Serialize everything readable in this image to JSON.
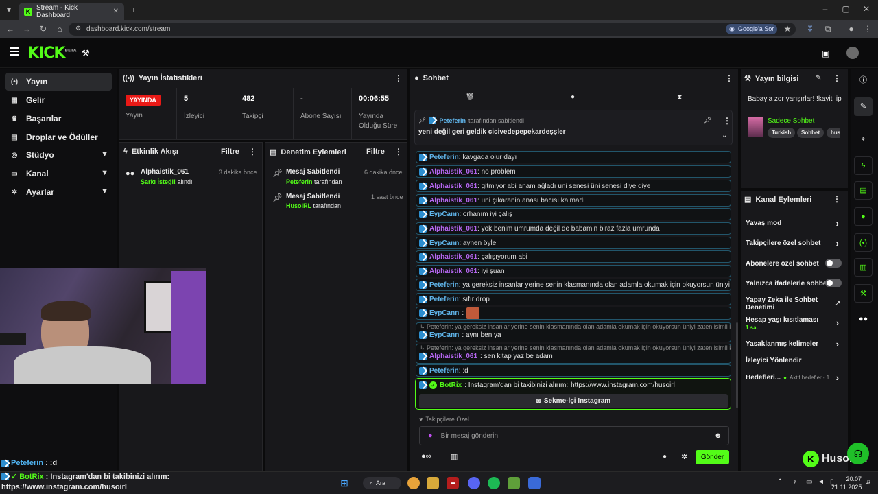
{
  "browser": {
    "tab_title": "Stream - Kick Dashboard",
    "url": "dashboard.kick.com/stream",
    "google_chip": "Google'a Sor"
  },
  "header": {
    "logo": "KICK",
    "logo_sup": "BETA"
  },
  "sidebar": {
    "items": [
      {
        "label": "Yayın",
        "icon": "broadcast-icon"
      },
      {
        "label": "Gelir",
        "icon": "money-icon"
      },
      {
        "label": "Başarılar",
        "icon": "trophy-icon"
      },
      {
        "label": "Droplar ve Ödüller",
        "icon": "gift-icon"
      },
      {
        "label": "Stüdyo",
        "icon": "studio-icon"
      },
      {
        "label": "Kanal",
        "icon": "channel-icon"
      },
      {
        "label": "Ayarlar",
        "icon": "gear-icon"
      }
    ]
  },
  "stats": {
    "title": "Yayın İstatistikleri",
    "live_badge": "YAYINDA",
    "cols": [
      {
        "value": "",
        "label": "Yayın"
      },
      {
        "value": "5",
        "label": "İzleyici"
      },
      {
        "value": "482",
        "label": "Takipçi"
      },
      {
        "value": "-",
        "label": "Abone Sayısı"
      },
      {
        "value": "00:06:55",
        "label": "Yayında Olduğu Süre"
      }
    ]
  },
  "activity": {
    "title": "Etkinlik Akışı",
    "filter": "Filtre",
    "items": [
      {
        "user": "Alphaistik_061",
        "time": "3 dakika önce",
        "highlight": "Şarkı İsteği!",
        "rest": " alındı"
      }
    ]
  },
  "moderation": {
    "title": "Denetim Eylemleri",
    "filter": "Filtre",
    "items": [
      {
        "title": "Mesaj Sabitlendi",
        "time": "6 dakika önce",
        "user": "Peteferin",
        "rest": " tarafından"
      },
      {
        "title": "Mesaj Sabitlendi",
        "time": "1 saat önce",
        "user": "HusoIRL",
        "rest": " tarafından"
      }
    ]
  },
  "chat": {
    "title": "Sohbet",
    "pinned_by": "Peteferin",
    "pinned_suffix": " tarafından sabitlendi",
    "pinned_text": "yeni değil geri geldik cicivedepepekardeşşler",
    "messages": [
      {
        "user": "Peteferin",
        "color": "blue",
        "text": ": kavgada olur dayı"
      },
      {
        "user": "Alphaistik_061",
        "color": "purple",
        "text": ": no problem"
      },
      {
        "user": "Alphaistik_061",
        "color": "purple",
        "text": ": gitmiyor abi anam ağladı uni senesi üni senesi diye diye"
      },
      {
        "user": "Alphaistik_061",
        "color": "purple",
        "text": ": uni çıkaranin anası bacısı kalmadı"
      },
      {
        "user": "EypCann",
        "color": "blue",
        "text": ": orhanım iyi çalış"
      },
      {
        "user": "Alphaistik_061",
        "color": "purple",
        "text": ": yok benim umrumda değil de babamin biraz fazla umrunda"
      },
      {
        "user": "EypCann",
        "color": "blue",
        "text": ": aynen öyle"
      },
      {
        "user": "Alphaistik_061",
        "color": "purple",
        "text": ": çalışıyorum abi"
      },
      {
        "user": "Alphaistik_061",
        "color": "purple",
        "text": ": iyi şuan"
      },
      {
        "user": "Peteferin",
        "color": "blue",
        "text": ": ya gereksiz insanlar yerine senin klasmanında olan adamla okumak için okuyorsun üniyi zaten"
      },
      {
        "user": "Peteferin",
        "color": "blue",
        "text": ": sıfır drop"
      },
      {
        "user": "EypCann",
        "color": "blue",
        "text": ":"
      }
    ],
    "reply1": "Peteferin: ya gereksiz insanlar yerine senin klasmanında olan adamla okumak için okuyorsun üniyi zaten isimli kul...",
    "msg_after1": {
      "user": "EypCann",
      "text": ": aynı ben ya"
    },
    "reply2": "Peteferin: ya gereksiz insanlar yerine senin klasmanında olan adamla okumak için okuyorsun üniyi zaten isimli kul...",
    "msg_after2": {
      "user": "Alphaistik_061",
      "text": ": sen kitap yaz be adam"
    },
    "msg_last": {
      "user": "Peteferin",
      "text": ": :d"
    },
    "bot": {
      "user": "BotRix",
      "text": ": Instagram'dan bi takibinizi alırım: ",
      "link": "https://www.instagram.com/husoirl",
      "button": "Sekme-İçi Instagram"
    },
    "follower_only": "Takipçilere Özel",
    "placeholder": "Bir mesaj gönderin",
    "send": "Gönder"
  },
  "info": {
    "title": "Yayın bilgisi",
    "stream_title": "Babayla zor yarışırlar! !kayit !ip",
    "category": "Sadece Sohbet",
    "tags": [
      "Turkish",
      "Sohbet",
      "hus"
    ]
  },
  "actions": {
    "title": "Kanal Eylemleri",
    "items": [
      {
        "label": "Yavaş mod",
        "type": "arrow"
      },
      {
        "label": "Takipçilere özel sohbet",
        "type": "arrow"
      },
      {
        "label": "Abonelere özel sohbet",
        "type": "toggle"
      },
      {
        "label": "Yalnızca ifadelerle sohbet",
        "type": "toggle"
      },
      {
        "label": "Yapay Zeka ile Sohbet Denetimi",
        "type": "external"
      },
      {
        "label": "Hesap yaşı kısıtlaması",
        "sub": "1 sa.",
        "type": "arrow"
      },
      {
        "label": "Yasaklanmış kelimeler",
        "type": "arrow"
      },
      {
        "label": "İzleyici Yönlendir",
        "type": "none"
      },
      {
        "label": "Hedefleri...",
        "sub": "Aktif hedefler - 1",
        "type": "arrow"
      }
    ]
  },
  "overlay": {
    "chat1_user": "Peteferin",
    "chat1_text": " : :d",
    "chat2_user": "BotRix",
    "chat2_text": " : Instagram'dan bi takibinizi alırım:",
    "chat2_link": "https://www.instagram.com/husoirl",
    "watermark": "HusoIRL"
  },
  "taskbar": {
    "search": "Ara",
    "time": "20:07",
    "date": "21.11.2025"
  }
}
